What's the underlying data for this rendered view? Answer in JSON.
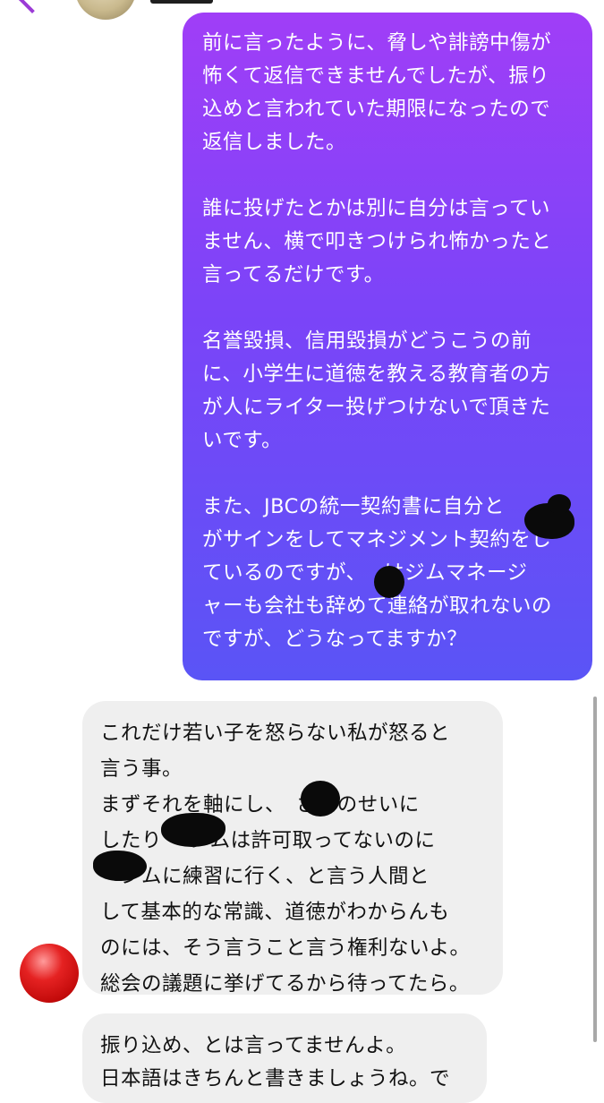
{
  "header": {
    "back_icon": "chevron-left-icon",
    "avatar_icon": "avatar",
    "name": ""
  },
  "messages": [
    {
      "direction": "outgoing",
      "text": "前に言ったように、脅しや誹謗中傷が\n怖くて返信できませんでしたが、振り\n込めと言われていた期限になったので\n返信しました。\n\n誰に投げたとかは別に自分は言ってい\nません、横で叩きつけられ怖かったと\n言ってるだけです。\n\n名誉毀損、信用毀損がどうこうの前\nに、小学生に道徳を教える教育者の方\nが人にライター投げつけないで頂きた\nいです。\n\nまた、JBCの統一契約書に自分と\nがサインをしてマネジメント契約をし\nているのですが、　 はジムマネージ\nャーも会社も辞めて連絡が取れないの\nですが、どうなってますか？"
    },
    {
      "direction": "incoming",
      "text": "これだけ若い子を怒らない私が怒ると\n言う事。\nまずそれを軸にし、　さんのせいに\nしたり　 ジムは許可取ってないのに\n　ジムに練習に行く、と言う人間と\nして基本的な常識、道徳がわからんも\nのには、そう言うこと言う権利ないよ。\n総会の議題に挙げてるから待ってたら。"
    },
    {
      "direction": "incoming",
      "text": "振り込め、とは言ってませんよ。\n日本語はきちんと書きましょうね。で"
    }
  ],
  "sender": {
    "avatar_icon": "red-circle-avatar"
  },
  "colors": {
    "outgoing_top": "#a03ef7",
    "outgoing_bottom": "#5a54f6",
    "incoming_bg": "#efefef",
    "accent": "#9b3bd6"
  }
}
